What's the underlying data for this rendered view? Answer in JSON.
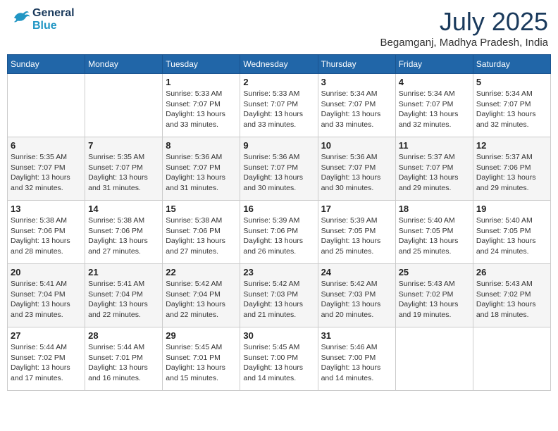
{
  "header": {
    "logo_general": "General",
    "logo_blue": "Blue",
    "month_title": "July 2025",
    "location": "Begamganj, Madhya Pradesh, India"
  },
  "weekdays": [
    "Sunday",
    "Monday",
    "Tuesday",
    "Wednesday",
    "Thursday",
    "Friday",
    "Saturday"
  ],
  "weeks": [
    [
      {
        "day": "",
        "info": ""
      },
      {
        "day": "",
        "info": ""
      },
      {
        "day": "1",
        "info": "Sunrise: 5:33 AM\nSunset: 7:07 PM\nDaylight: 13 hours\nand 33 minutes."
      },
      {
        "day": "2",
        "info": "Sunrise: 5:33 AM\nSunset: 7:07 PM\nDaylight: 13 hours\nand 33 minutes."
      },
      {
        "day": "3",
        "info": "Sunrise: 5:34 AM\nSunset: 7:07 PM\nDaylight: 13 hours\nand 33 minutes."
      },
      {
        "day": "4",
        "info": "Sunrise: 5:34 AM\nSunset: 7:07 PM\nDaylight: 13 hours\nand 32 minutes."
      },
      {
        "day": "5",
        "info": "Sunrise: 5:34 AM\nSunset: 7:07 PM\nDaylight: 13 hours\nand 32 minutes."
      }
    ],
    [
      {
        "day": "6",
        "info": "Sunrise: 5:35 AM\nSunset: 7:07 PM\nDaylight: 13 hours\nand 32 minutes."
      },
      {
        "day": "7",
        "info": "Sunrise: 5:35 AM\nSunset: 7:07 PM\nDaylight: 13 hours\nand 31 minutes."
      },
      {
        "day": "8",
        "info": "Sunrise: 5:36 AM\nSunset: 7:07 PM\nDaylight: 13 hours\nand 31 minutes."
      },
      {
        "day": "9",
        "info": "Sunrise: 5:36 AM\nSunset: 7:07 PM\nDaylight: 13 hours\nand 30 minutes."
      },
      {
        "day": "10",
        "info": "Sunrise: 5:36 AM\nSunset: 7:07 PM\nDaylight: 13 hours\nand 30 minutes."
      },
      {
        "day": "11",
        "info": "Sunrise: 5:37 AM\nSunset: 7:07 PM\nDaylight: 13 hours\nand 29 minutes."
      },
      {
        "day": "12",
        "info": "Sunrise: 5:37 AM\nSunset: 7:06 PM\nDaylight: 13 hours\nand 29 minutes."
      }
    ],
    [
      {
        "day": "13",
        "info": "Sunrise: 5:38 AM\nSunset: 7:06 PM\nDaylight: 13 hours\nand 28 minutes."
      },
      {
        "day": "14",
        "info": "Sunrise: 5:38 AM\nSunset: 7:06 PM\nDaylight: 13 hours\nand 27 minutes."
      },
      {
        "day": "15",
        "info": "Sunrise: 5:38 AM\nSunset: 7:06 PM\nDaylight: 13 hours\nand 27 minutes."
      },
      {
        "day": "16",
        "info": "Sunrise: 5:39 AM\nSunset: 7:06 PM\nDaylight: 13 hours\nand 26 minutes."
      },
      {
        "day": "17",
        "info": "Sunrise: 5:39 AM\nSunset: 7:05 PM\nDaylight: 13 hours\nand 25 minutes."
      },
      {
        "day": "18",
        "info": "Sunrise: 5:40 AM\nSunset: 7:05 PM\nDaylight: 13 hours\nand 25 minutes."
      },
      {
        "day": "19",
        "info": "Sunrise: 5:40 AM\nSunset: 7:05 PM\nDaylight: 13 hours\nand 24 minutes."
      }
    ],
    [
      {
        "day": "20",
        "info": "Sunrise: 5:41 AM\nSunset: 7:04 PM\nDaylight: 13 hours\nand 23 minutes."
      },
      {
        "day": "21",
        "info": "Sunrise: 5:41 AM\nSunset: 7:04 PM\nDaylight: 13 hours\nand 22 minutes."
      },
      {
        "day": "22",
        "info": "Sunrise: 5:42 AM\nSunset: 7:04 PM\nDaylight: 13 hours\nand 22 minutes."
      },
      {
        "day": "23",
        "info": "Sunrise: 5:42 AM\nSunset: 7:03 PM\nDaylight: 13 hours\nand 21 minutes."
      },
      {
        "day": "24",
        "info": "Sunrise: 5:42 AM\nSunset: 7:03 PM\nDaylight: 13 hours\nand 20 minutes."
      },
      {
        "day": "25",
        "info": "Sunrise: 5:43 AM\nSunset: 7:02 PM\nDaylight: 13 hours\nand 19 minutes."
      },
      {
        "day": "26",
        "info": "Sunrise: 5:43 AM\nSunset: 7:02 PM\nDaylight: 13 hours\nand 18 minutes."
      }
    ],
    [
      {
        "day": "27",
        "info": "Sunrise: 5:44 AM\nSunset: 7:02 PM\nDaylight: 13 hours\nand 17 minutes."
      },
      {
        "day": "28",
        "info": "Sunrise: 5:44 AM\nSunset: 7:01 PM\nDaylight: 13 hours\nand 16 minutes."
      },
      {
        "day": "29",
        "info": "Sunrise: 5:45 AM\nSunset: 7:01 PM\nDaylight: 13 hours\nand 15 minutes."
      },
      {
        "day": "30",
        "info": "Sunrise: 5:45 AM\nSunset: 7:00 PM\nDaylight: 13 hours\nand 14 minutes."
      },
      {
        "day": "31",
        "info": "Sunrise: 5:46 AM\nSunset: 7:00 PM\nDaylight: 13 hours\nand 14 minutes."
      },
      {
        "day": "",
        "info": ""
      },
      {
        "day": "",
        "info": ""
      }
    ]
  ]
}
